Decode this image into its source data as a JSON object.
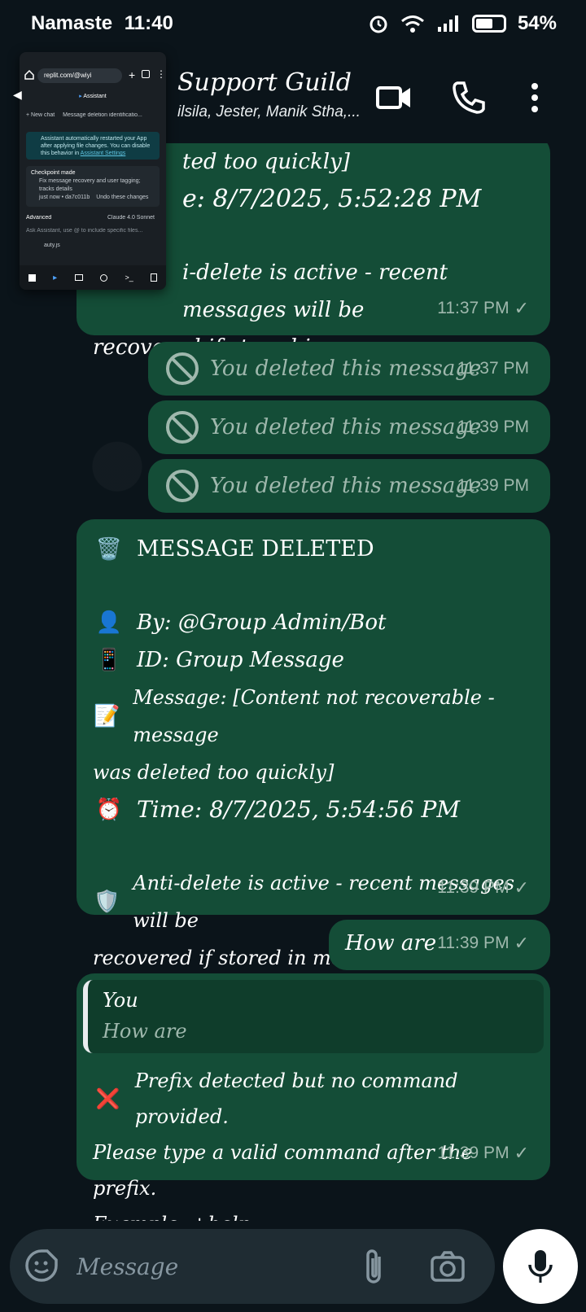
{
  "status": {
    "carrier": "Namaste",
    "time": "11:40",
    "battery": "54%"
  },
  "header": {
    "title": "Support Guild",
    "subtitle": "ilsila, Jester, Manik Stha,..."
  },
  "overlay": {
    "url": "replit.com/@wiyi",
    "tab_title": "Assistant",
    "new_chat": "+ New chat",
    "chat_name": "Message deletion identificatio...",
    "notice_text": "Assistant automatically restarted your App after applying file changes. You can disable this behavior in",
    "notice_link": "Assistant Settings",
    "checkpoint_title": "Checkpoint made",
    "checkpoint_desc": "Fix message recovery and user tagging; tracks details",
    "checkpoint_time": "just now",
    "checkpoint_hash": "da7c011b",
    "checkpoint_undo": "Undo these changes",
    "mode": "Advanced",
    "model": "Claude 4.0 Sonnet",
    "input_placeholder": "Ask Assistant, use @ to include specific files...",
    "attached": "auty.js"
  },
  "messages": [
    {
      "line1": "ted too quickly]",
      "line2": "e: 8/7/2025, 5:52:28 PM",
      "line3": "i-delete is active - recent messages will be",
      "line4": "recovered if stored in memory",
      "time": "11:37 PM"
    },
    {
      "deleted": "You deleted this message",
      "time": "11:37 PM"
    },
    {
      "deleted": "You deleted this message",
      "time": "11:39 PM"
    },
    {
      "deleted": "You deleted this message",
      "time": "11:39 PM"
    },
    {
      "heading": "MESSAGE DELETED",
      "by": "By: @Group Admin/Bot",
      "id": "ID: Group Message",
      "msg1": "Message: [Content not recoverable - message",
      "msg2": "was deleted too quickly]",
      "time_line": "Time: 8/7/2025, 5:54:56 PM",
      "anti1": "Anti-delete is active - recent messages will be",
      "anti2": "recovered if stored in memory",
      "time": "11:39 PM"
    },
    {
      "text": "How are",
      "time": "11:39 PM"
    },
    {
      "quote_author": "You",
      "quote_text": "How are",
      "line1": "Prefix detected but no command provided.",
      "line2": "Please type a valid command after the prefix.",
      "line3": "Example: +help",
      "time": "11:39 PM"
    }
  ],
  "input": {
    "placeholder": "Message"
  }
}
